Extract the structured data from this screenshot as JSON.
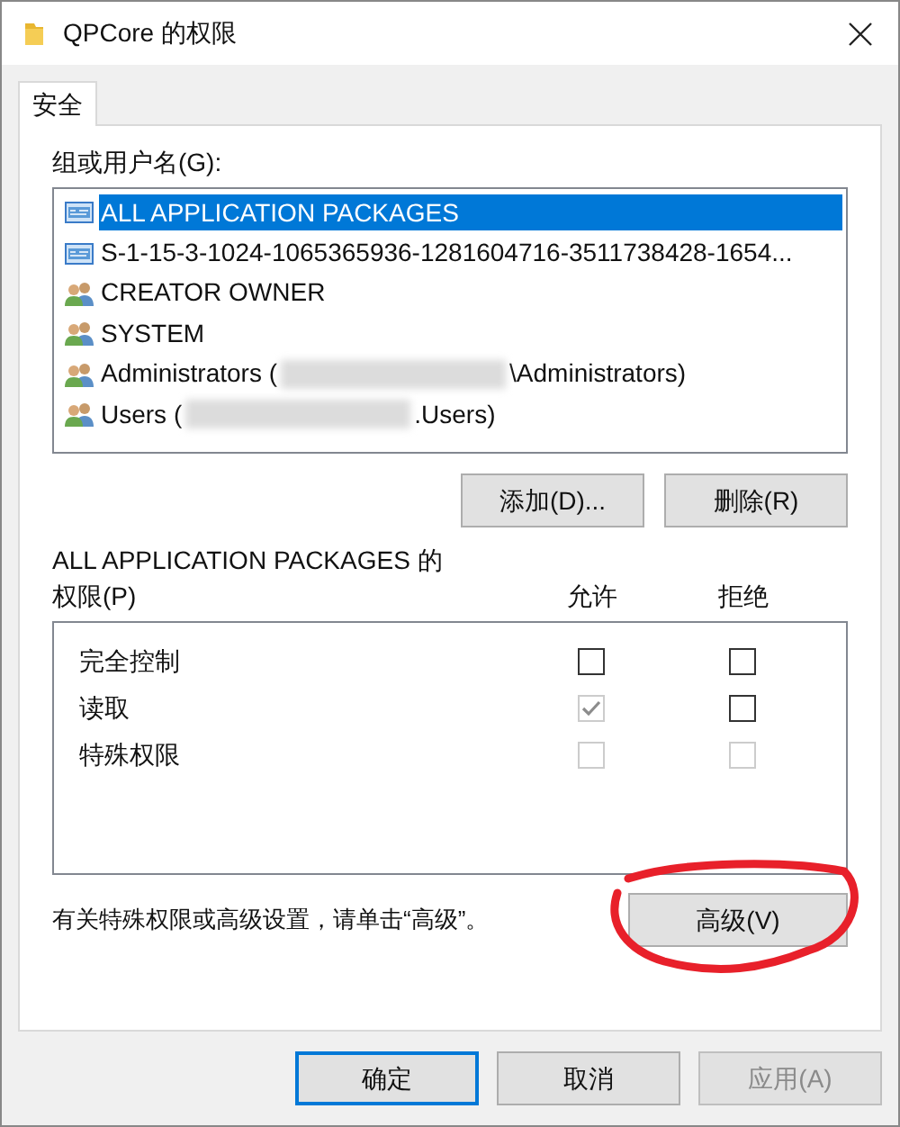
{
  "window": {
    "title": "QPCore 的权限"
  },
  "tabs": [
    {
      "label": "安全",
      "selected": true
    }
  ],
  "principals_label": "组或用户名(G):",
  "principals": [
    {
      "kind": "package",
      "text": "ALL APPLICATION PACKAGES",
      "selected": true
    },
    {
      "kind": "package",
      "text": "S-1-15-3-1024-1065365936-1281604716-3511738428-1654...",
      "selected": false
    },
    {
      "kind": "user",
      "text": "CREATOR OWNER",
      "selected": false
    },
    {
      "kind": "user",
      "text": "SYSTEM",
      "selected": false
    },
    {
      "kind": "user",
      "text": "Administrators (",
      "redacted": true,
      "suffix": "\\Administrators)",
      "selected": false
    },
    {
      "kind": "user",
      "text": "Users (",
      "redacted": true,
      "suffix": ".Users)",
      "selected": false
    }
  ],
  "list_buttons": [
    "添加(D)...",
    "删除(R)"
  ],
  "permissions_label": "ALL APPLICATION PACKAGES 的",
  "permissions_label_2": "权限(P)",
  "columns": [
    "允许",
    "拒绝"
  ],
  "permissions": [
    {
      "name": "完全控制",
      "allow": {
        "checked": false,
        "disabled": false
      },
      "deny": {
        "checked": false,
        "disabled": false
      }
    },
    {
      "name": "读取",
      "allow": {
        "checked": true,
        "disabled": true
      },
      "deny": {
        "checked": false,
        "disabled": false
      }
    },
    {
      "name": "特殊权限",
      "allow": {
        "checked": false,
        "disabled": true
      },
      "deny": {
        "checked": false,
        "disabled": true
      }
    }
  ],
  "hint": "有关特殊权限或高级设置，请单击“高级”。",
  "advanced_button": "高级(V)",
  "footer_buttons": [
    {
      "label": "确定",
      "kind": "default",
      "disabled": false
    },
    {
      "label": "取消",
      "kind": "normal",
      "disabled": false
    },
    {
      "label": "应用(A)",
      "kind": "normal",
      "disabled": true
    }
  ]
}
